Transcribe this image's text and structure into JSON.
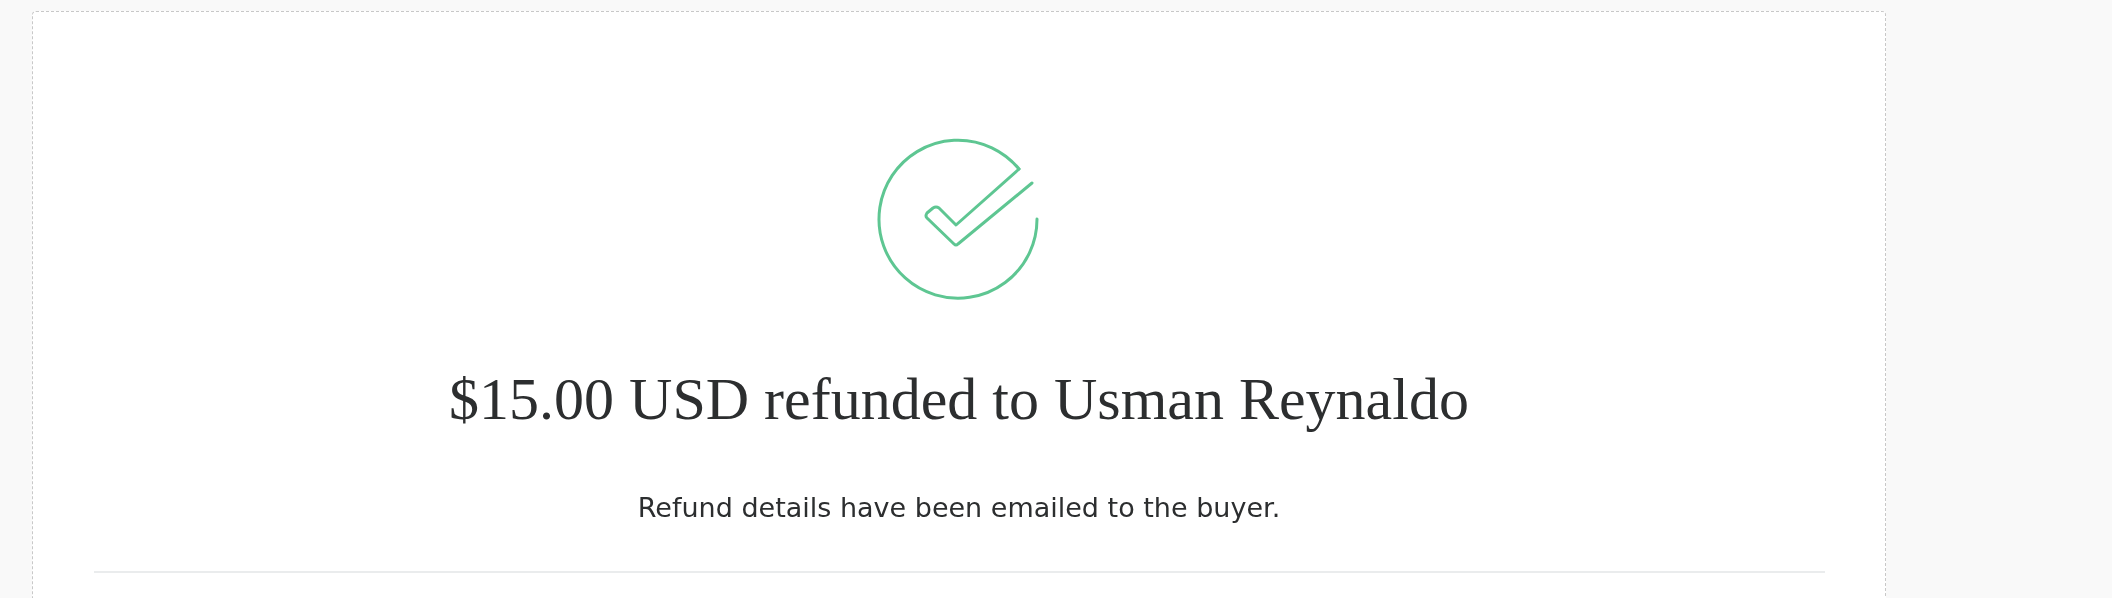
{
  "confirmation": {
    "heading": "$15.00 USD refunded to Usman Reynaldo",
    "message": "Refund details have been emailed to the buyer."
  }
}
